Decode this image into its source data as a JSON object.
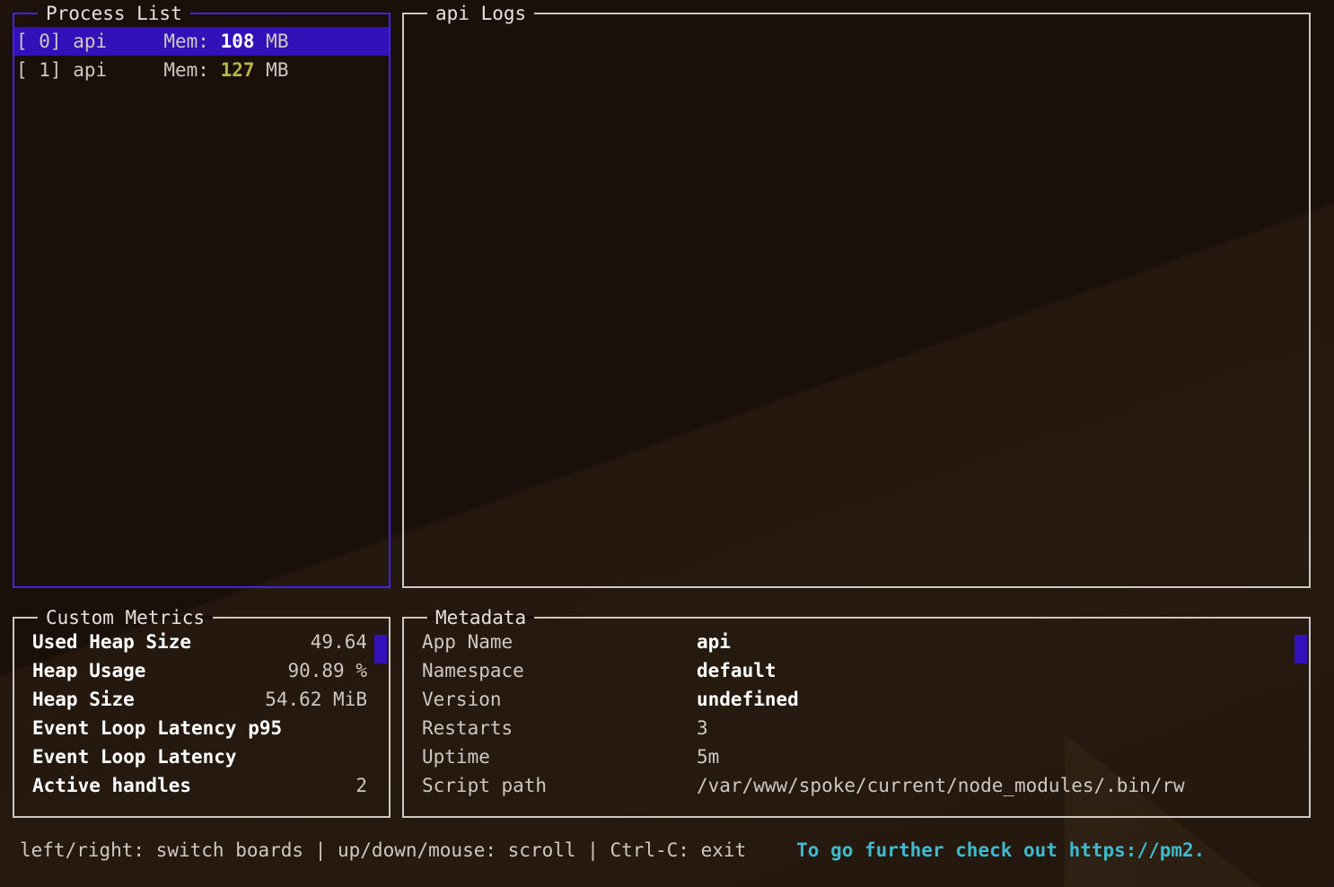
{
  "panels": {
    "process_list": {
      "title": "Process List",
      "focused": true,
      "rows": [
        {
          "index": "[ 0]",
          "name": "api",
          "mem_label": "Mem:",
          "mem_value": "108",
          "mem_unit": "MB",
          "selected": true,
          "level": "ok"
        },
        {
          "index": "[ 1]",
          "name": "api",
          "mem_label": "Mem:",
          "mem_value": "127",
          "mem_unit": "MB",
          "selected": false,
          "level": "warn"
        }
      ]
    },
    "logs": {
      "title": "api Logs",
      "lines": []
    },
    "custom_metrics": {
      "title": "Custom Metrics",
      "rows": [
        {
          "label": "Used Heap Size",
          "value": "49.64"
        },
        {
          "label": "Heap Usage",
          "value": "90.89 %"
        },
        {
          "label": "Heap Size",
          "value": "54.62 MiB"
        },
        {
          "label": "Event Loop Latency p95",
          "value": ""
        },
        {
          "label": "Event Loop Latency",
          "value": ""
        },
        {
          "label": "Active handles",
          "value": "2"
        }
      ]
    },
    "metadata": {
      "title": "Metadata",
      "rows": [
        {
          "label": "App Name",
          "value": "api",
          "strong": true
        },
        {
          "label": "Namespace",
          "value": "default",
          "strong": true
        },
        {
          "label": "Version",
          "value": "undefined",
          "strong": true
        },
        {
          "label": "Restarts",
          "value": "3",
          "strong": false
        },
        {
          "label": "Uptime",
          "value": "5m",
          "strong": false
        },
        {
          "label": "Script path",
          "value": "/var/www/spoke/current/node_modules/.bin/rw",
          "strong": false
        }
      ]
    }
  },
  "footer": {
    "help": "left/right: switch boards | up/down/mouse: scroll | Ctrl-C: exit",
    "link": "To go further check out https://pm2."
  },
  "colors": {
    "background": "#1b0f0a",
    "text": "#cfc8c2",
    "border": "#cfc8c2",
    "border_focused": "#4420ee",
    "selection": "#3311b8",
    "warn": "#b5b54a",
    "link": "#3fb9cc",
    "bright": "#ffffff"
  },
  "icons": {
    "scrollbar": "scrollbar-thumb-icon"
  }
}
